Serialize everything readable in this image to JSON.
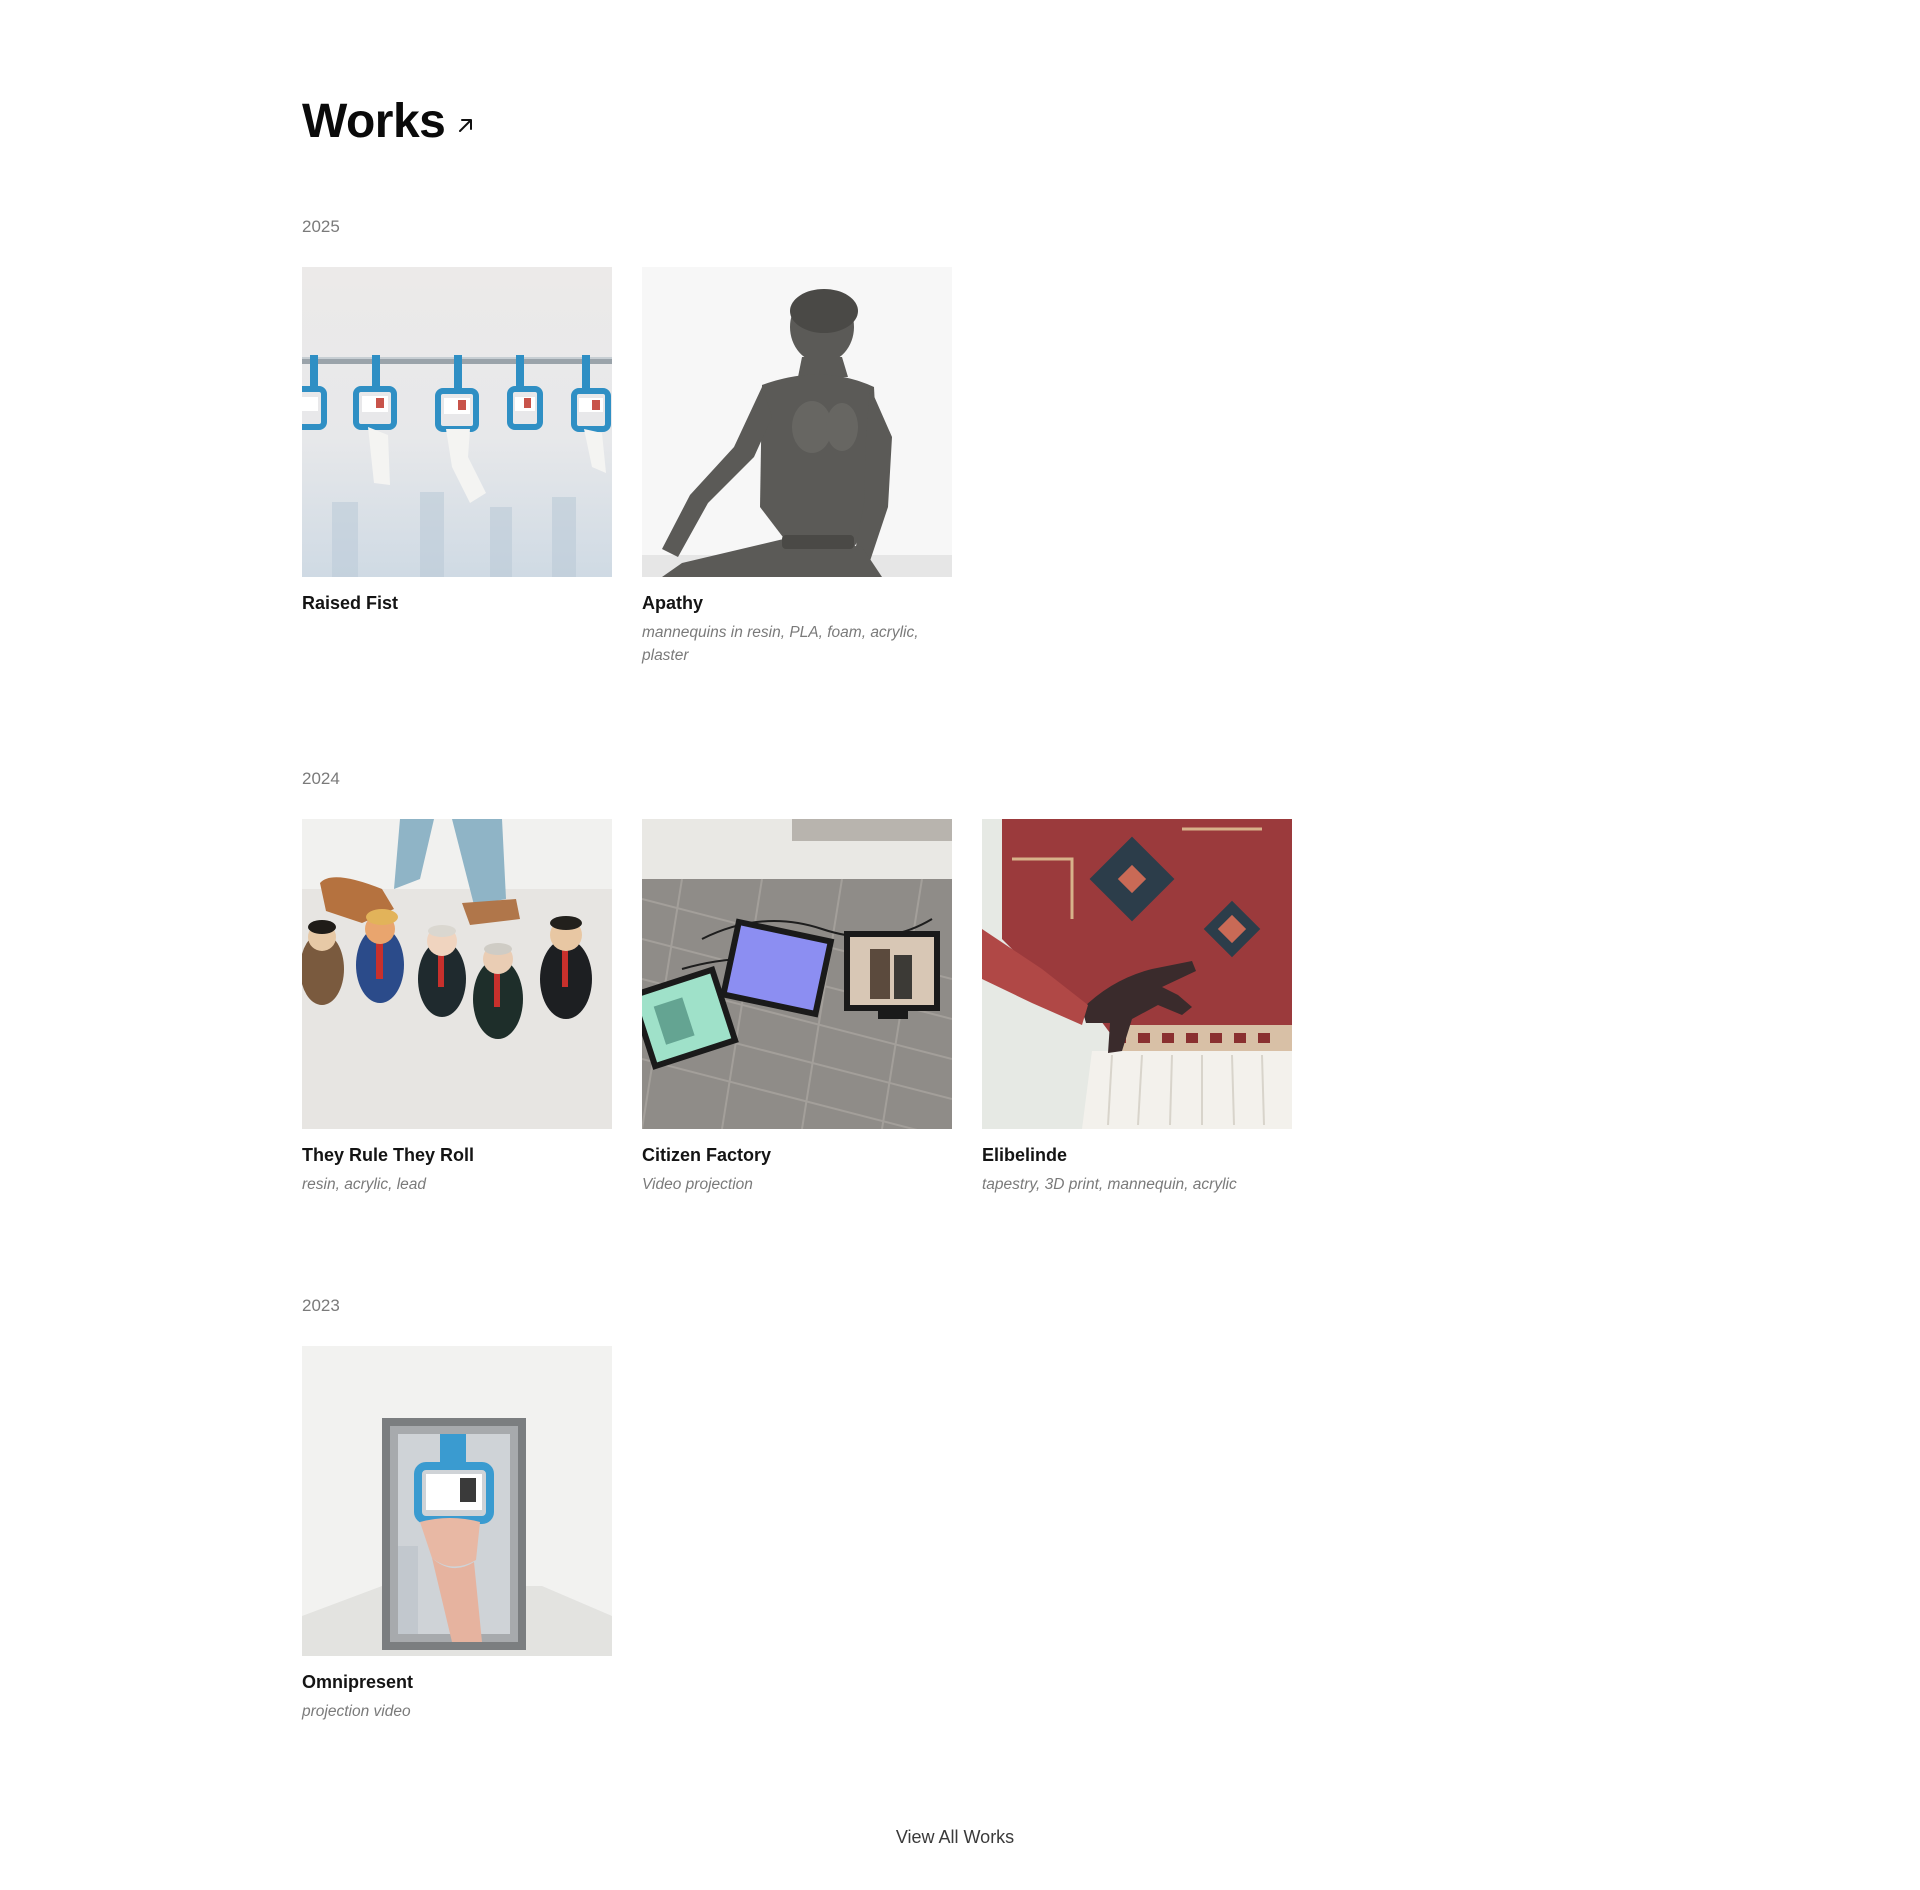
{
  "header": {
    "title": "Works",
    "arrow_icon": "arrow-up-right-icon"
  },
  "sections": [
    {
      "year": "2025",
      "works": [
        {
          "title": "Raised Fist",
          "medium": ""
        },
        {
          "title": "Apathy",
          "medium": "mannequins in resin, PLA, foam, acrylic, plaster"
        }
      ]
    },
    {
      "year": "2024",
      "works": [
        {
          "title": "They Rule They Roll",
          "medium": "resin, acrylic, lead"
        },
        {
          "title": "Citizen Factory",
          "medium": "Video projection"
        },
        {
          "title": "Elibelinde",
          "medium": "tapestry, 3D print, mannequin, acrylic"
        }
      ]
    },
    {
      "year": "2023",
      "works": [
        {
          "title": "Omnipresent",
          "medium": "projection video"
        }
      ]
    }
  ],
  "footer": {
    "view_all_label": "View All Works"
  },
  "colors": {
    "year_label": "#7a7a7a",
    "medium_text": "#7a7a7a",
    "title_text": "#141414",
    "accent_blue": "#2f8fc4"
  }
}
